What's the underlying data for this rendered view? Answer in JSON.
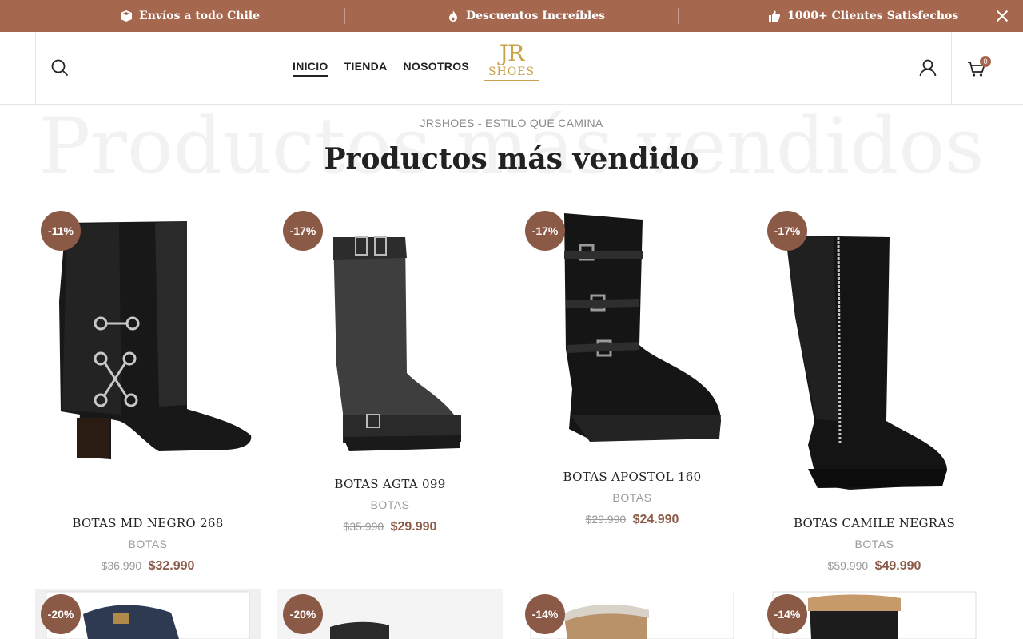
{
  "topbar": {
    "items": [
      {
        "icon": "box-icon",
        "label": "Envíos a todo Chile"
      },
      {
        "icon": "fire-icon",
        "label": "Descuentos Increíbles"
      },
      {
        "icon": "thumbs-up-icon",
        "label": "1000+ Clientes Satisfechos"
      }
    ],
    "bg_color": "#a5684f"
  },
  "header": {
    "nav": [
      "INICIO",
      "TIENDA",
      "NOSOTROS"
    ],
    "active_nav": "INICIO",
    "logo": {
      "line1": "JR",
      "line2": "SHOES",
      "color": "#c9a24a"
    },
    "cart_count": "0"
  },
  "section": {
    "background_title": "Productos más vendidos",
    "eyebrow": "JRSHOES - ESTILO QUE CAMINA",
    "title": "Productos más vendido"
  },
  "products": [
    {
      "name": "BOTAS MD NEGRO 268",
      "category": "BOTAS",
      "old_price": "$36.990",
      "price": "$32.990",
      "discount": "-11%"
    },
    {
      "name": "BOTAS AGTA 099",
      "category": "BOTAS",
      "old_price": "$35.990",
      "price": "$29.990",
      "discount": "-17%"
    },
    {
      "name": "BOTAS APOSTOL 160",
      "category": "BOTAS",
      "old_price": "$29.990",
      "price": "$24.990",
      "discount": "-17%"
    },
    {
      "name": "BOTAS CAMILE NEGRAS",
      "category": "BOTAS",
      "old_price": "$59.990",
      "price": "$49.990",
      "discount": "-17%"
    }
  ],
  "row2_discounts": [
    "-20%",
    "-20%",
    "-14%",
    "-14%"
  ],
  "colors": {
    "accent": "#8b5a47",
    "gold": "#c9a24a"
  }
}
